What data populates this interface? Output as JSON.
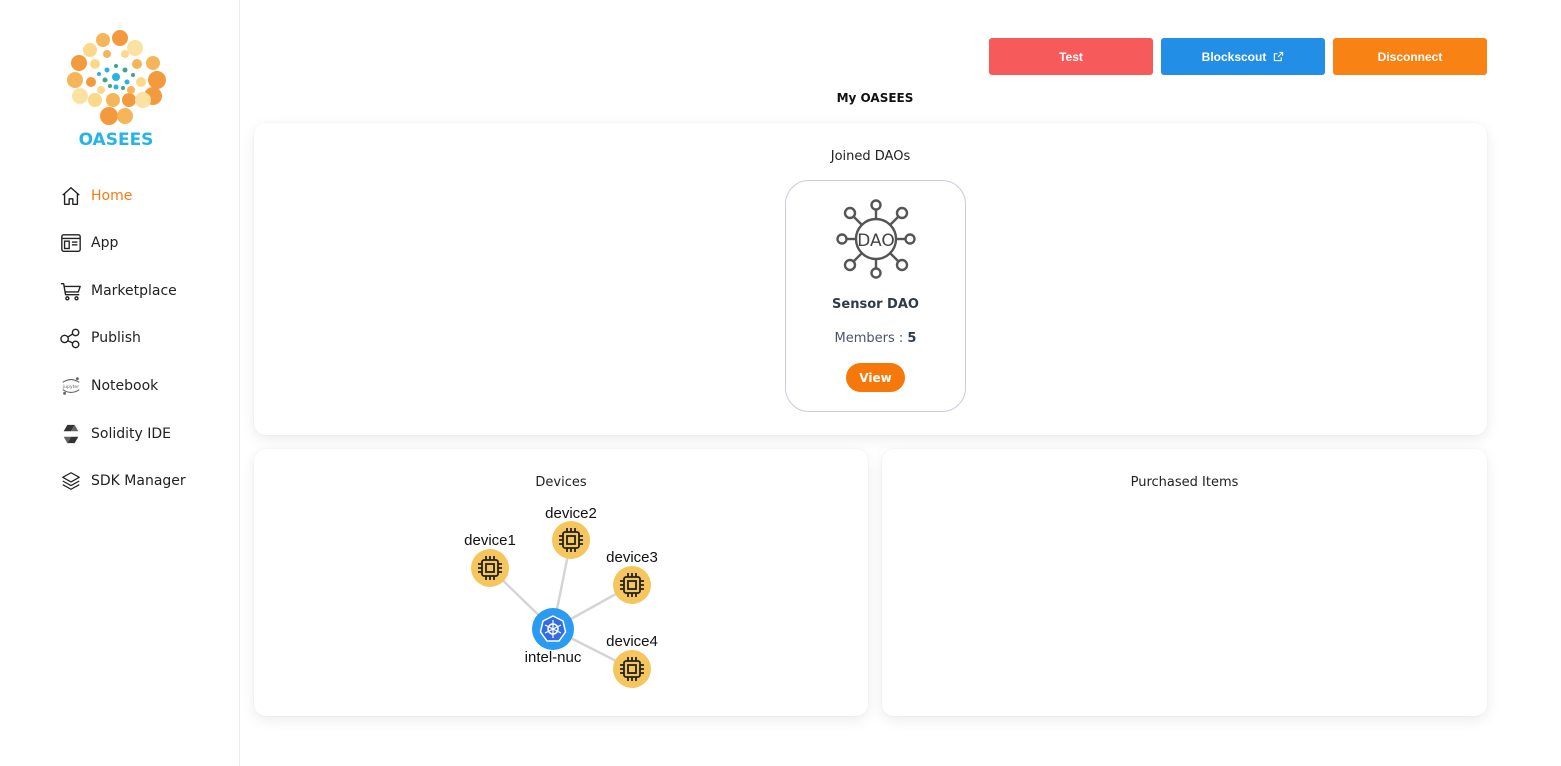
{
  "sidebar": {
    "brand": "OASEES",
    "items": [
      {
        "label": "Home",
        "icon": "home-icon",
        "active": true
      },
      {
        "label": "App",
        "icon": "app-icon"
      },
      {
        "label": "Marketplace",
        "icon": "cart-icon"
      },
      {
        "label": "Publish",
        "icon": "share-icon"
      },
      {
        "label": "Notebook",
        "icon": "jupyter-icon"
      },
      {
        "label": "Solidity IDE",
        "icon": "solidity-icon"
      },
      {
        "label": "SDK Manager",
        "icon": "sdk-layers-icon"
      }
    ]
  },
  "header": {
    "test_label": "Test",
    "blockscout_label": "Blockscout",
    "disconnect_label": "Disconnect",
    "title": "My OASEES"
  },
  "joined_daos": {
    "title": "Joined DAOs",
    "dao": {
      "name": "Sensor DAO",
      "members_label": "Members :",
      "members_count": "5",
      "view_label": "View",
      "icon_text": "DAO"
    }
  },
  "devices": {
    "title": "Devices",
    "hub": "intel-nuc",
    "nodes": [
      "device1",
      "device2",
      "device3",
      "device4"
    ]
  },
  "purchased": {
    "title": "Purchased Items"
  },
  "colors": {
    "accent_orange": "#f7780a",
    "test_red": "#f65a5b",
    "blockscout_blue": "#238ee6",
    "brand_cyan": "#27b3e6",
    "device_yellow": "#f5c65e",
    "kubernetes_blue": "#326ce5"
  }
}
